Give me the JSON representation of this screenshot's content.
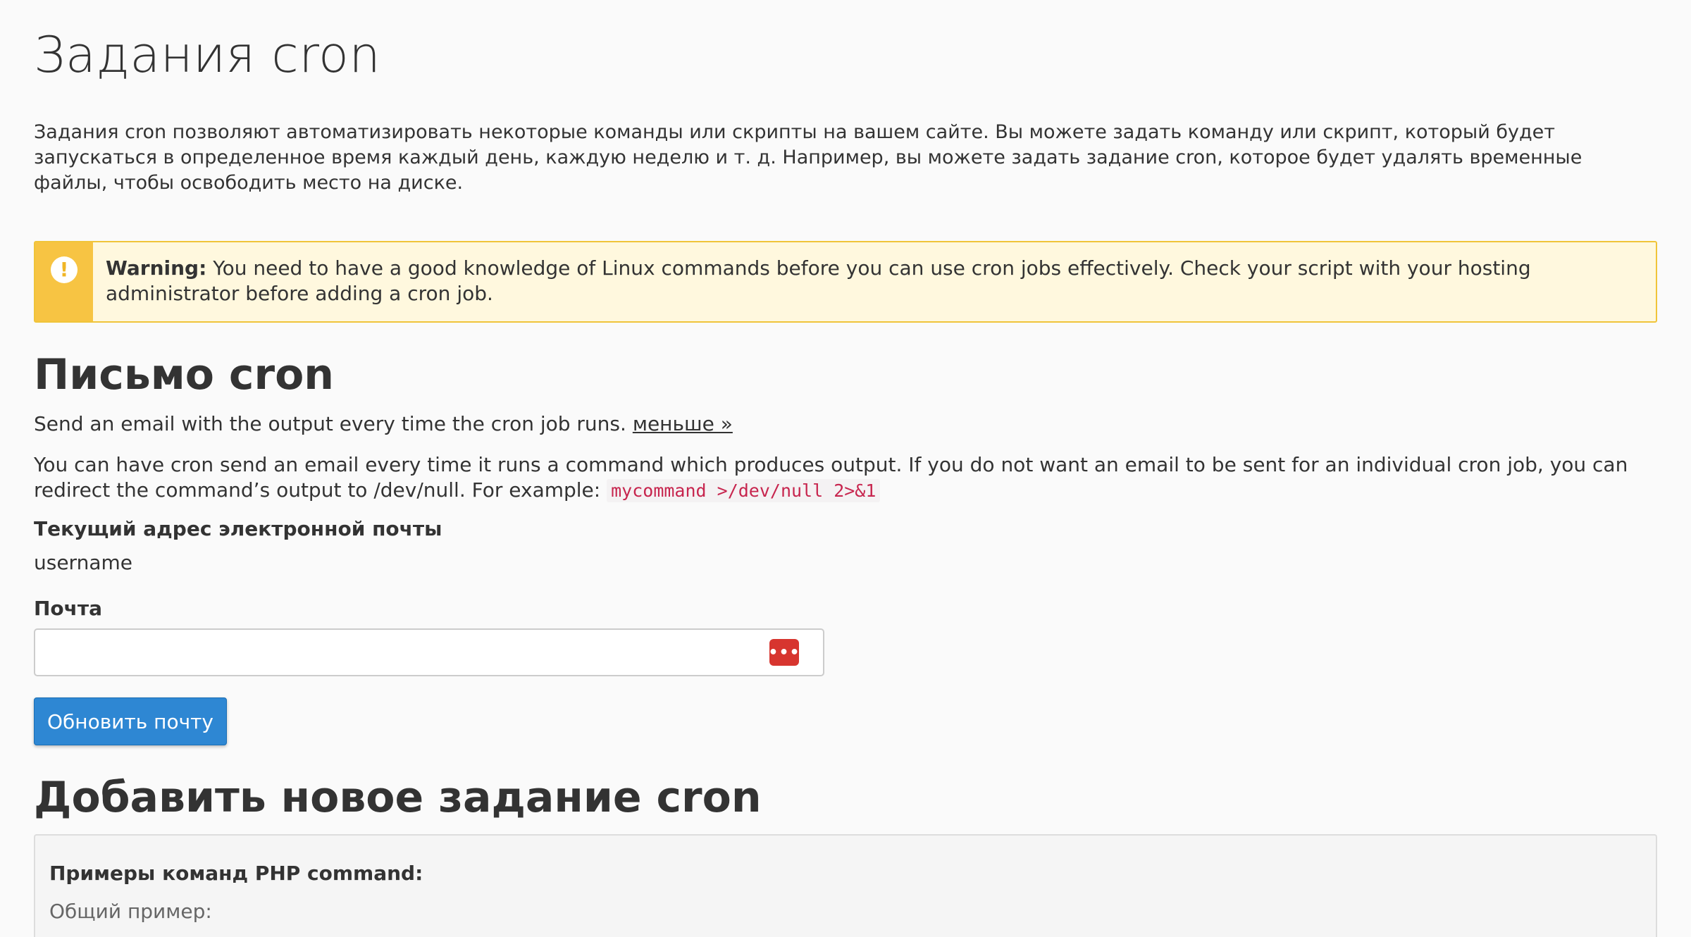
{
  "page": {
    "title": "Задания cron",
    "intro": "Задания cron позволяют автоматизировать некоторые команды или скрипты на вашем сайте. Вы можете задать команду или скрипт, который будет запускаться в определенное время каждый день, каждую неделю и т. д. Например, вы можете задать задание cron, которое будет удалять временные файлы, чтобы освободить место на диске."
  },
  "warning": {
    "label": "Warning:",
    "text": " You need to have a good knowledge of Linux commands before you can use cron jobs effectively. Check your script with your hosting administrator before adding a cron job.",
    "icon": "exclamation-icon",
    "stripe_color": "#f7c443"
  },
  "cron_email": {
    "heading": "Письмо cron",
    "description": "Send an email with the output every time the cron job runs. ",
    "less_link": "меньше »",
    "details": "You can have cron send an email every time it runs a command which produces output. If you do not want an email to be sent for an individual cron job, you can redirect the command’s output to /dev/null. For example: ",
    "example_code": "mycommand >/dev/null 2>&1",
    "current_label": "Текущий адрес электронной почты",
    "current_value": "username",
    "email_label": "Почта",
    "email_value": "",
    "email_placeholder": "",
    "update_button": "Обновить почту"
  },
  "add_cron": {
    "heading": "Добавить новое задание cron",
    "examples_title": "Примеры команд PHP command:",
    "examples_sub": "Общий пример:"
  },
  "colors": {
    "button_blue": "#2e87d3",
    "code_red": "#c7254e",
    "password_icon_red": "#d7352f"
  }
}
